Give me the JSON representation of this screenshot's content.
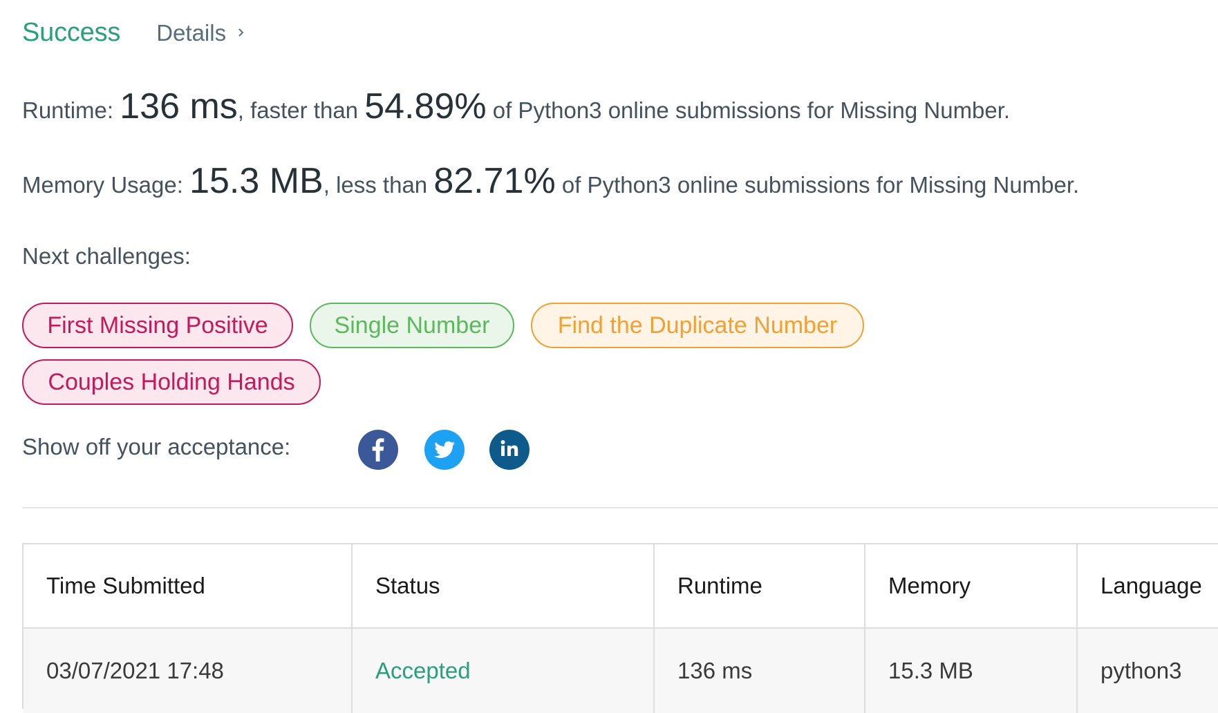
{
  "header": {
    "status": "Success",
    "details_label": "Details"
  },
  "result": {
    "runtime_label": "Runtime:",
    "runtime_value": "136 ms",
    "runtime_compare": ", faster than ",
    "runtime_percent": "54.89%",
    "runtime_suffix": " of Python3 online submissions for Missing Number.",
    "memory_label": "Memory Usage:",
    "memory_value": "15.3 MB",
    "memory_compare": ", less than ",
    "memory_percent": "82.71%",
    "memory_suffix": " of Python3 online submissions for Missing Number."
  },
  "next": {
    "label": "Next challenges:",
    "tags": [
      {
        "label": "First Missing Positive",
        "difficulty": "hard"
      },
      {
        "label": "Single Number",
        "difficulty": "easy"
      },
      {
        "label": "Find the Duplicate Number",
        "difficulty": "medium"
      },
      {
        "label": "Couples Holding Hands",
        "difficulty": "hard"
      }
    ]
  },
  "share": {
    "label": "Show off your acceptance:",
    "buttons": [
      {
        "icon": "facebook-icon",
        "color": "#3b5998"
      },
      {
        "icon": "twitter-icon",
        "color": "#1da1f2"
      },
      {
        "icon": "linkedin-icon",
        "color": "#0e5a8a"
      }
    ]
  },
  "table": {
    "headers": [
      "Time Submitted",
      "Status",
      "Runtime",
      "Memory",
      "Language"
    ],
    "rows": [
      [
        "03/07/2021 17:48",
        "Accepted",
        "136 ms",
        "15.3 MB",
        "python3"
      ]
    ]
  },
  "colors": {
    "success": "#26a17b",
    "hard": "#c4195a",
    "easy": "#5cb85c",
    "medium": "#f0a132"
  }
}
